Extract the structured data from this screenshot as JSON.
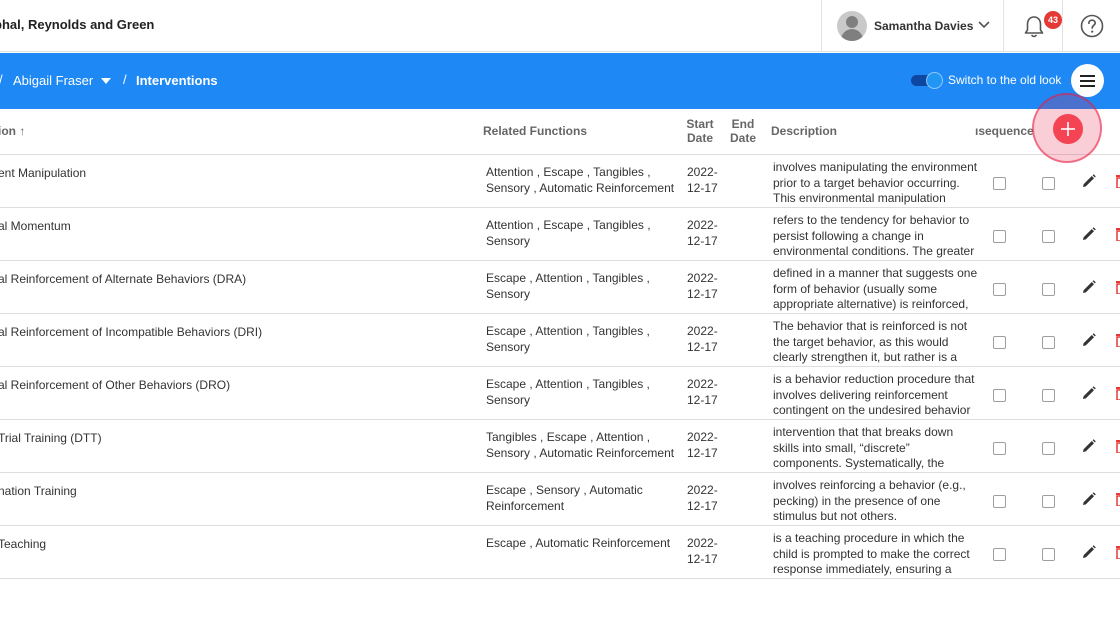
{
  "header": {
    "org_name": "phal, Reynolds and Green",
    "user_name": "Samantha Davies",
    "notification_count": "43"
  },
  "breadcrumb": {
    "separator": "/",
    "client": "Abigail Fraser",
    "current": "Interventions"
  },
  "toggle": {
    "label": "Switch to the old look",
    "on": true
  },
  "table": {
    "headers": {
      "intervention": "ion ↑",
      "functions": "Related Functions",
      "start": "Start Date",
      "end": "End Date",
      "description": "Description",
      "sequence": "ısequence"
    },
    "rows": [
      {
        "name": "ent Manipulation",
        "functions": "Attention , Escape , Tangibles , Sensory , Automatic Reinforcement",
        "start": "2022-12-17",
        "end": "",
        "description": "involves manipulating the environment prior to a target behavior occurring. This environmental manipulation increases"
      },
      {
        "name": "al Momentum",
        "functions": "Attention , Escape , Tangibles , Sensory",
        "start": "2022-12-17",
        "end": "",
        "description": "refers to the tendency for behavior to persist following a change in environmental conditions. The greater"
      },
      {
        "name": "al Reinforcement of Alternate Behaviors (DRA)",
        "functions": "Escape , Attention , Tangibles , Sensory",
        "start": "2022-12-17",
        "end": "",
        "description": "defined in a manner that suggests one form of behavior (usually some appropriate alternative) is reinforced,"
      },
      {
        "name": "al Reinforcement of Incompatible Behaviors (DRI)",
        "functions": "Escape , Attention , Tangibles , Sensory",
        "start": "2022-12-17",
        "end": "",
        "description": "The behavior that is reinforced is not the target behavior, as this would clearly strengthen it, but rather is a behavior"
      },
      {
        "name": "al Reinforcement of Other Behaviors (DRO)",
        "functions": "Escape , Attention , Tangibles , Sensory",
        "start": "2022-12-17",
        "end": "",
        "description": "is a behavior reduction procedure that involves delivering reinforcement contingent on the undesired behavior"
      },
      {
        "name": "Trial Training (DTT)",
        "functions": "Tangibles , Escape , Attention , Sensory , Automatic Reinforcement",
        "start": "2022-12-17",
        "end": "",
        "description": "intervention that that breaks down skills into small, “discrete” components. Systematically, the trainer teaches these"
      },
      {
        "name": "nation Training",
        "functions": "Escape , Sensory , Automatic Reinforcement",
        "start": "2022-12-17",
        "end": "",
        "description": "involves reinforcing a behavior (e.g., pecking) in the presence of one stimulus but not others."
      },
      {
        "name": "Teaching",
        "functions": "Escape , Automatic Reinforcement",
        "start": "2022-12-17",
        "end": "",
        "description": "is a teaching procedure in which the child is prompted to make the correct response immediately, ensuring a"
      }
    ]
  },
  "colors": {
    "primary_blue": "#1e88f5",
    "badge_red": "#e53935",
    "fab_red": "#f44352",
    "delete_red": "#e53935"
  }
}
